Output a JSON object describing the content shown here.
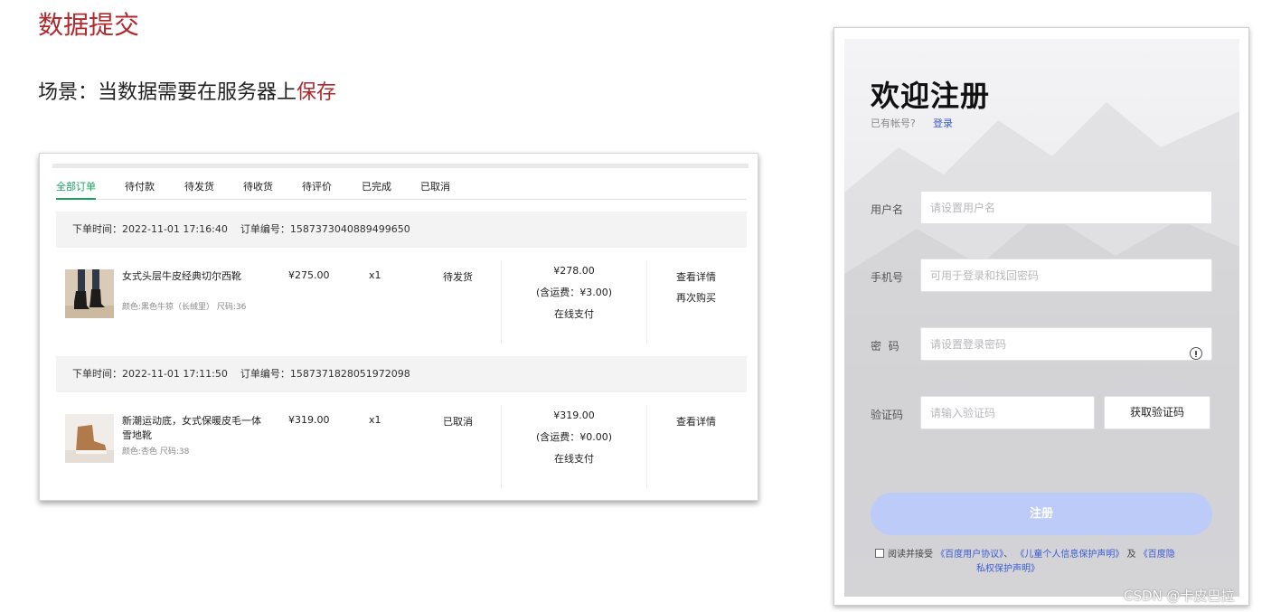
{
  "slide": {
    "title": "数据提交",
    "scene_prefix": "场景：当数据需要在服务器上",
    "scene_highlight": "保存"
  },
  "orders": {
    "tabs": [
      {
        "label": "全部订单",
        "active": true
      },
      {
        "label": "待付款",
        "active": false
      },
      {
        "label": "待发货",
        "active": false
      },
      {
        "label": "待收货",
        "active": false
      },
      {
        "label": "待评价",
        "active": false
      },
      {
        "label": "已完成",
        "active": false
      },
      {
        "label": "已取消",
        "active": false
      }
    ],
    "list": [
      {
        "time_label": "下单时间：2022-11-01 17:16:40",
        "order_no_label": "订单编号：1587373040889499650",
        "product_name": "女式头层牛皮经典切尔西靴",
        "product_attrs": "颜色:黑色牛猄（长绒里） 尺码:36",
        "unit_price": "¥275.00",
        "quantity": "x1",
        "status": "待发货",
        "total": "¥278.00",
        "shipping": "(含运费：¥3.00)",
        "payment": "在线支付",
        "actions": [
          "查看详情",
          "再次购买"
        ]
      },
      {
        "time_label": "下单时间：2022-11-01 17:11:50",
        "order_no_label": "订单编号：1587371828051972098",
        "product_name": "新潮运动底，女式保暖皮毛一体雪地靴",
        "product_attrs": "颜色:杏色 尺码:38",
        "unit_price": "¥319.00",
        "quantity": "x1",
        "status": "已取消",
        "total": "¥319.00",
        "shipping": "(含运费：¥0.00)",
        "payment": "在线支付",
        "actions": [
          "查看详情"
        ]
      }
    ]
  },
  "register": {
    "title": "欢迎注册",
    "have_account": "已有帐号?",
    "login_link": "登录",
    "fields": {
      "username": {
        "label": "用户名",
        "placeholder": "请设置用户名"
      },
      "phone": {
        "label": "手机号",
        "placeholder": "可用于登录和找回密码"
      },
      "password": {
        "label": "密  码",
        "placeholder": "请设置登录密码"
      },
      "code": {
        "label": "验证码",
        "placeholder": "请输入验证码"
      }
    },
    "get_code_button": "获取验证码",
    "submit_button": "注册",
    "agree_prefix": "阅读并接受",
    "agree_link_1": "《百度用户协议》",
    "agree_sep": "、",
    "agree_link_2": "《儿童个人信息保护声明》",
    "agree_and": "及",
    "agree_link_3a": "《百度隐",
    "agree_link_3b": "私权保护声明》"
  },
  "watermark": "CSDN @卡皮巴拉",
  "colors": {
    "slide_red": "#b0282c",
    "tab_active_green": "#19a15f",
    "price_red": "#e0322b",
    "link_blue": "#3b5bd6",
    "submit_disabled_blue": "#bccbf7"
  },
  "icons": [
    "boot-black-image",
    "boot-tan-image",
    "password-visibility-icon",
    "checkbox-icon"
  ]
}
